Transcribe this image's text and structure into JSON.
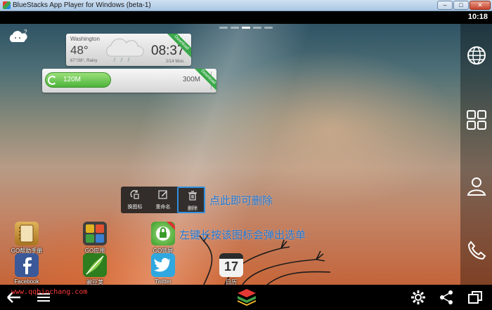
{
  "window": {
    "title": "BlueStacks App Player for Windows (beta-1)",
    "minimize": "–",
    "maximize": "□",
    "close": "✕"
  },
  "status": {
    "clock": "10:18"
  },
  "weather": {
    "city": "Washington",
    "temperature": "48°",
    "range": "67°/38°, Rainy",
    "time": "08:37",
    "date": "2/14 Mon.",
    "ribbon": "Download"
  },
  "memory": {
    "used": "120M",
    "total": "300M",
    "ribbon": "Download",
    "used_fraction": 0.4
  },
  "popup": {
    "items": [
      {
        "label": "换图标",
        "icon": "change-icon-icon"
      },
      {
        "label": "重命名",
        "icon": "rename-icon"
      },
      {
        "label": "删除",
        "icon": "trash-icon"
      }
    ]
  },
  "callouts": {
    "delete_hint": "点此即可删除",
    "longpress_hint": "左键长按该图标会弹出选单"
  },
  "apps": [
    {
      "name": "GO帮助手册",
      "color": "#c9922e"
    },
    {
      "name": "GO应用",
      "color": "#7fb23a"
    },
    {
      "name": "GO锁屏",
      "color": "#55b246"
    },
    {
      "name": "Facebook",
      "color": "#3b5998"
    },
    {
      "name": "豌豆荚",
      "color": "#6abf3c"
    },
    {
      "name": "Twitter",
      "color": "#2fa8e0"
    },
    {
      "name": "日历",
      "day": "17",
      "color": "#f2f2f2"
    }
  ],
  "watermark": "www.qqbinchang.com",
  "colors": {
    "accent": "#1f77d4",
    "download_ribbon": "#3aa84a",
    "memory_bar": "#4db33a"
  }
}
